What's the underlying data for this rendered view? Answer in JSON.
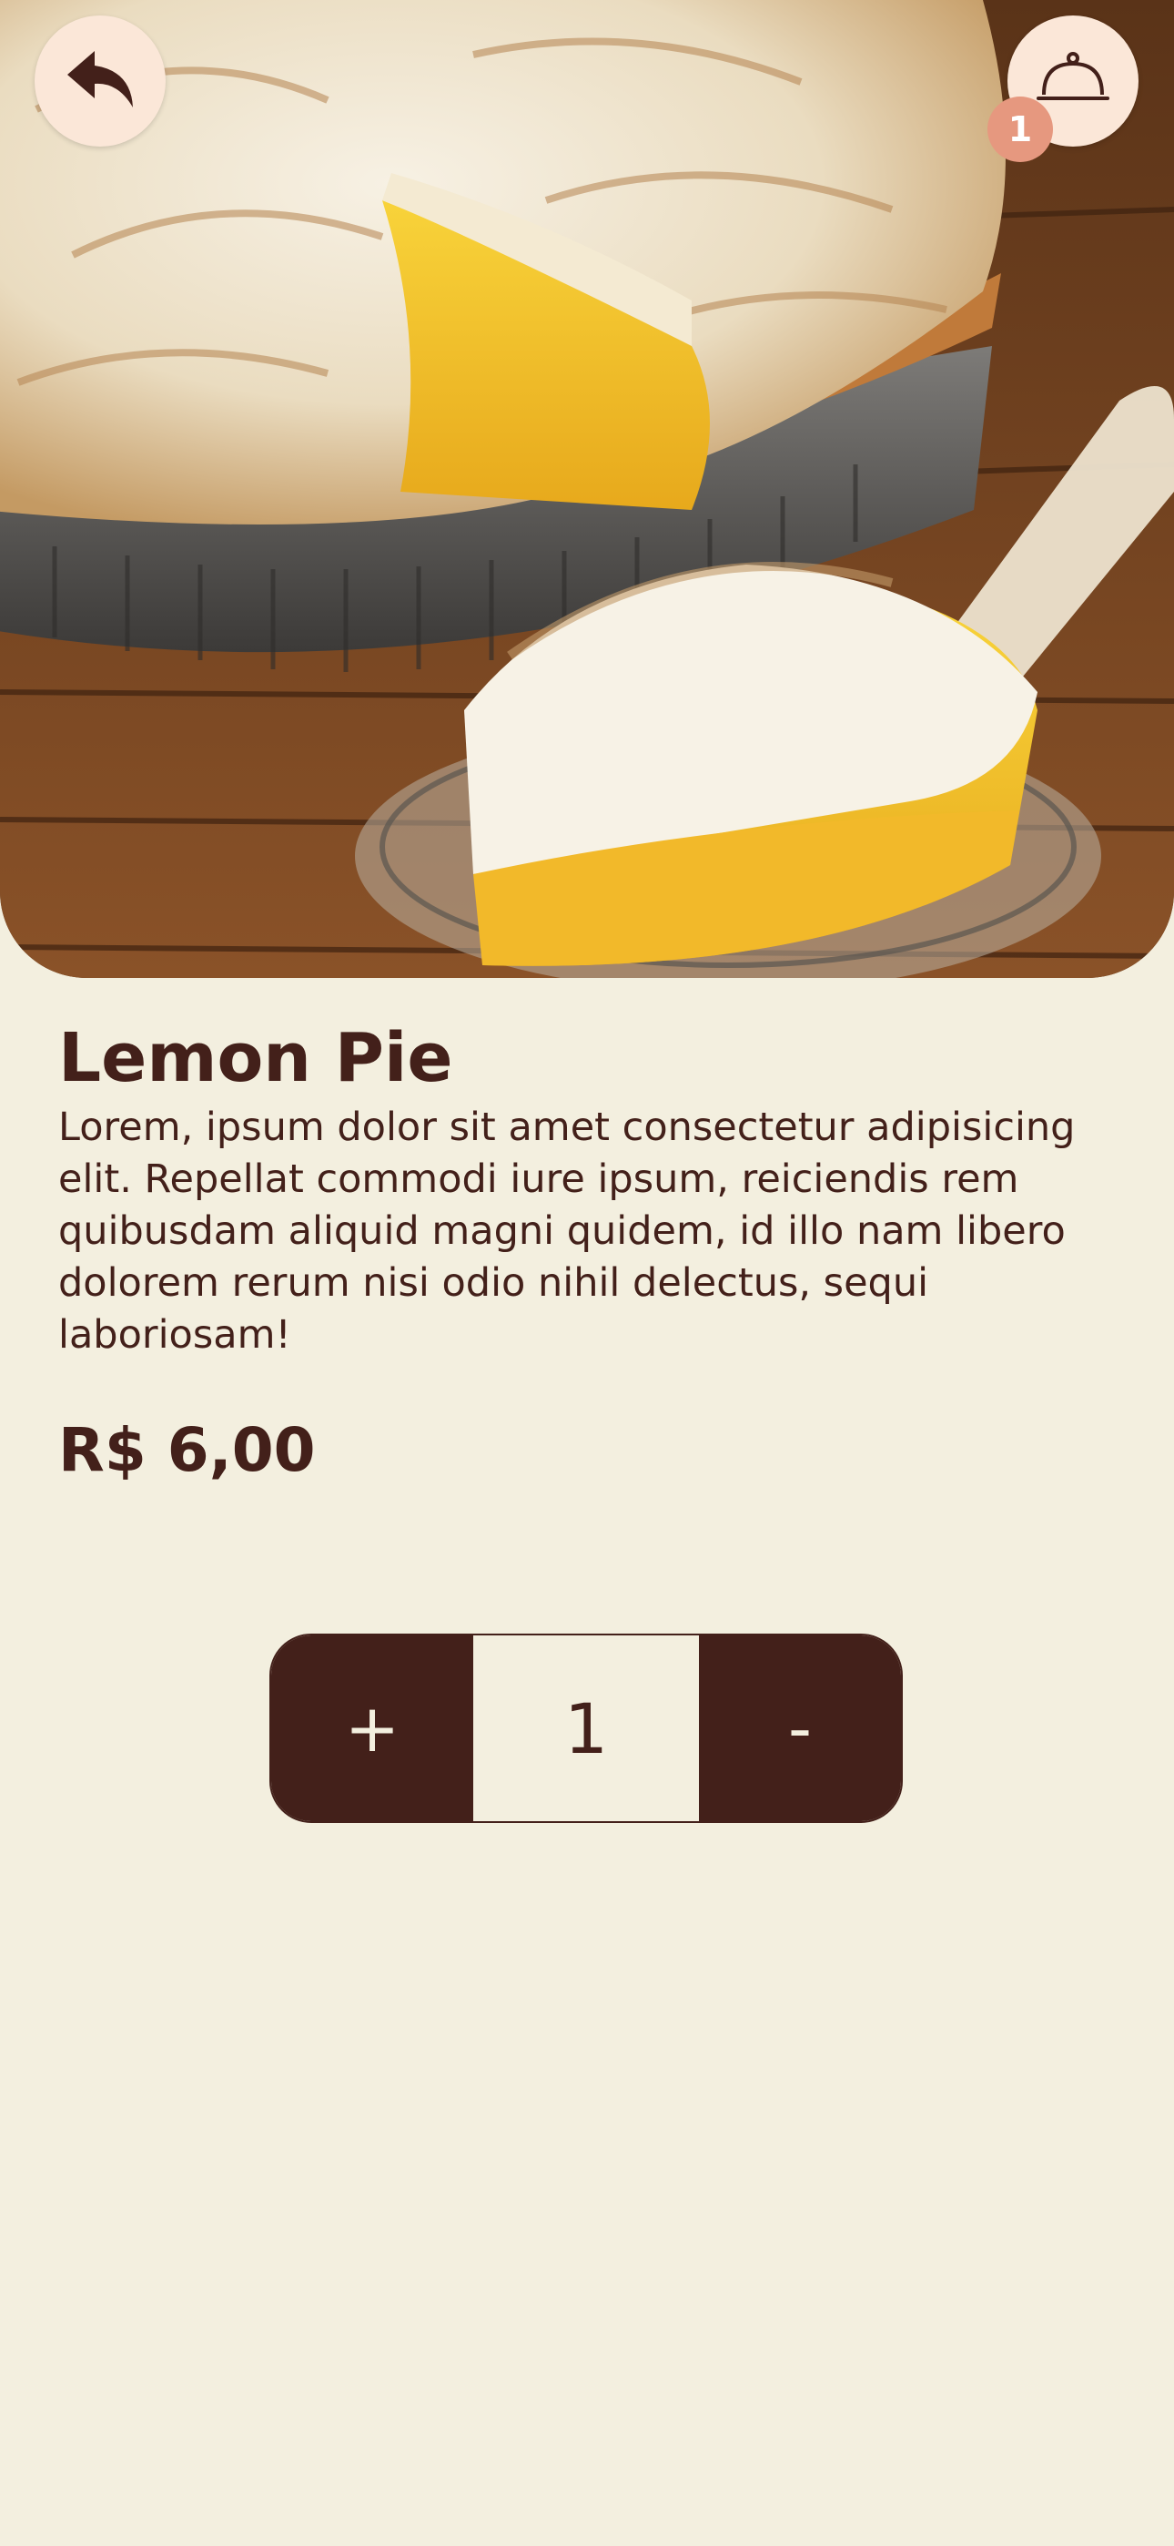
{
  "product": {
    "image_icon": "lemon-meringue-pie-photo",
    "name": "Lemon Pie",
    "description": "Lorem, ipsum dolor sit amet consectetur adipisicing elit. Repellat commodi iure ipsum, reiciendis rem quibusdam aliquid magni quidem, id illo nam libero dolorem rerum nisi odio nihil delectus, sequi laboriosam!",
    "price": "R$ 6,00"
  },
  "header": {
    "back_icon": "reply-arrow-icon",
    "cart_icon": "cloche-icon",
    "cart_badge_count": "1"
  },
  "stepper": {
    "increment_label": "+",
    "quantity": "1",
    "decrement_label": "-"
  },
  "colors": {
    "background": "#f3efdf",
    "primary": "#43201a",
    "button_bg": "#fbe7d8",
    "badge": "#e6987f"
  }
}
